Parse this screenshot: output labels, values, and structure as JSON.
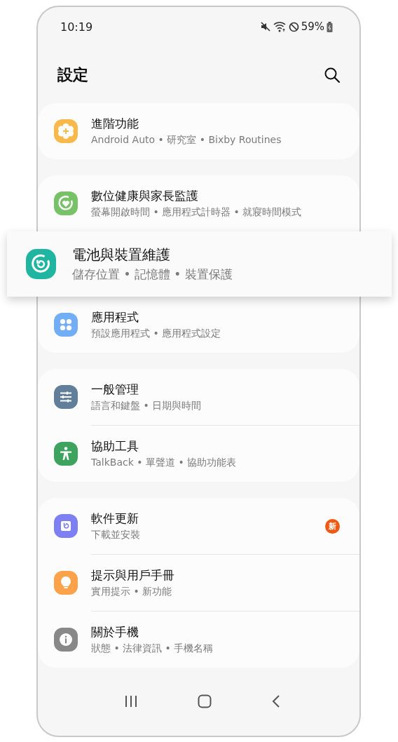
{
  "status_bar": {
    "time": "10:19",
    "battery": "59%"
  },
  "header": {
    "title": "設定"
  },
  "groups": [
    {
      "items": [
        {
          "kind": "advanced",
          "color": "#f8b84a",
          "title": "進階功能",
          "subtitle": "Android Auto • 研究室 • Bixby Routines",
          "highlighted": false
        }
      ]
    },
    {
      "items": [
        {
          "kind": "wellbeing",
          "color": "#77c167",
          "title": "數位健康與家長監護",
          "subtitle": "螢幕開啟時間 • 應用程式計時器 • 就寢時間模式",
          "highlighted": false
        },
        {
          "kind": "care",
          "color": "#1fb5a0",
          "title": "電池與裝置維護",
          "subtitle": "儲存位置 • 記憶體 • 裝置保護",
          "highlighted": true
        },
        {
          "kind": "apps",
          "color": "#71aef5",
          "title": "應用程式",
          "subtitle": "預設應用程式 • 應用程式設定",
          "highlighted": false
        }
      ]
    },
    {
      "items": [
        {
          "kind": "general",
          "color": "#617f9b",
          "title": "一般管理",
          "subtitle": "語言和鍵盤 • 日期與時間",
          "highlighted": false
        },
        {
          "kind": "accessibility",
          "color": "#3da35f",
          "title": "協助工具",
          "subtitle": "TalkBack • 單聲道 • 協助功能表",
          "highlighted": false
        }
      ]
    },
    {
      "items": [
        {
          "kind": "update",
          "color": "#7d7ff2",
          "title": "軟件更新",
          "subtitle": "下載並安裝",
          "badge": "新",
          "highlighted": false
        },
        {
          "kind": "tips",
          "color": "#fba24b",
          "title": "提示與用戶手冊",
          "subtitle": "實用提示 • 新功能",
          "highlighted": false
        },
        {
          "kind": "about",
          "color": "#888888",
          "title": "關於手機",
          "subtitle": "狀態 • 法律資訊 • 手機名稱",
          "highlighted": false
        }
      ]
    }
  ]
}
